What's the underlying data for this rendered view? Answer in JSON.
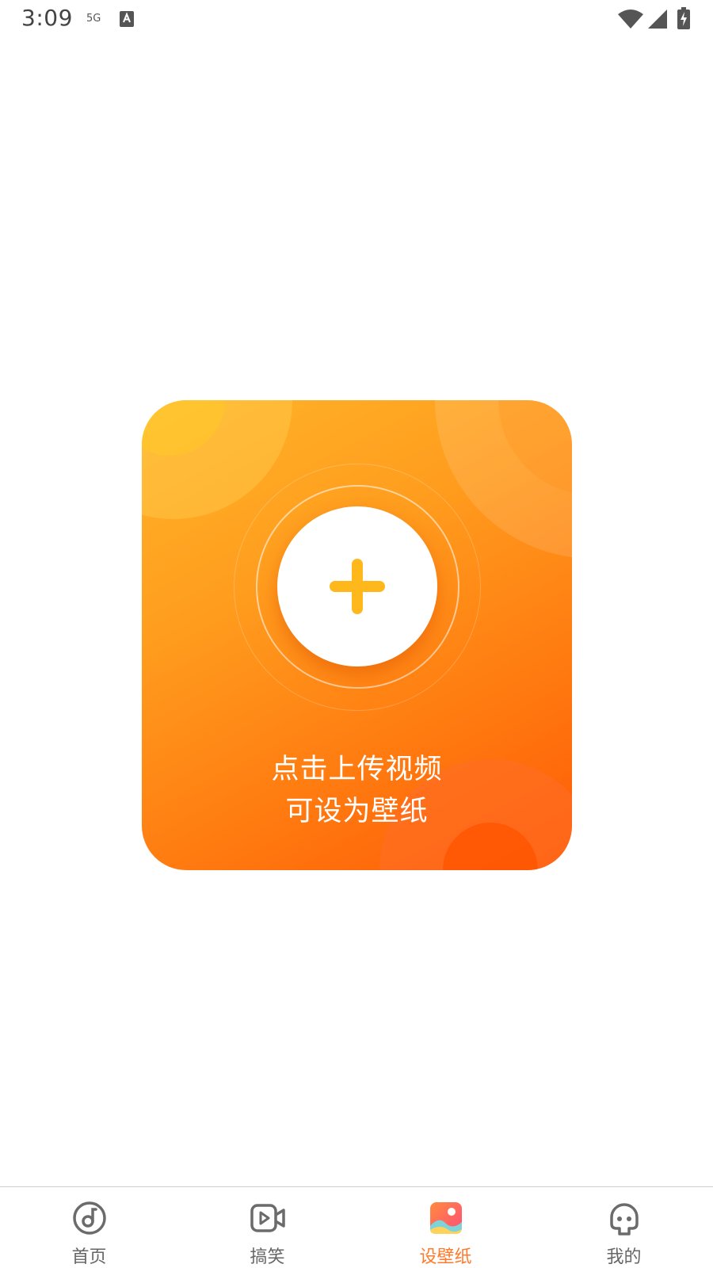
{
  "status_bar": {
    "time": "3:09",
    "network": "5G",
    "icons": [
      "a-notification-icon",
      "wifi-icon",
      "signal-icon",
      "battery-charging-icon"
    ]
  },
  "upload_card": {
    "line1": "点击上传视频",
    "line2": "可设为壁纸",
    "icon": "plus-icon",
    "colors": {
      "gradient_start": "#ffb42a",
      "gradient_end": "#ff5a05",
      "plus": "#ffb81c"
    }
  },
  "bottom_nav": {
    "active_index": 2,
    "active_color": "#ff7a2a",
    "items": [
      {
        "label": "首页",
        "icon": "music-disc-icon"
      },
      {
        "label": "搞笑",
        "icon": "video-camera-icon"
      },
      {
        "label": "设壁纸",
        "icon": "wallpaper-image-icon"
      },
      {
        "label": "我的",
        "icon": "profile-ghost-icon"
      }
    ]
  }
}
